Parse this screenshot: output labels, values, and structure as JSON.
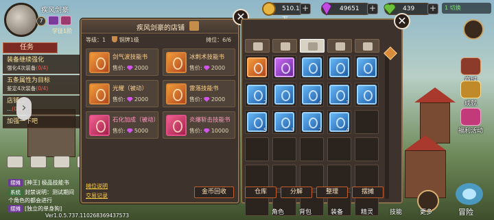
{
  "topbar": {
    "player_name": "疾风剑豪",
    "level": "7",
    "rank": "学徒1阶",
    "gold": "510.13万",
    "gems": "49651",
    "energy": "439",
    "status": "1 切换"
  },
  "tasks": {
    "tab_label": "任务",
    "items": [
      {
        "title": "装备继续强化",
        "desc": "强化4次装备",
        "progress": "(0/4)"
      },
      {
        "title": "五条属性为目标",
        "desc": "鉴定4次装备",
        "progress": "(0/4)"
      },
      {
        "title": "店铺...",
        "desc": "...",
        "progress": "(0/1)"
      },
      {
        "title": "加强一下吧",
        "desc": "",
        "progress": ""
      }
    ]
  },
  "chat": {
    "lines": [
      {
        "tag": "摆摊",
        "text": "[神王] 极品技能书"
      },
      {
        "tag": "系统",
        "text": "封禁说明：测试期间"
      },
      {
        "tag": "",
        "text": "个角色的都会进行"
      },
      {
        "tag": "摆摊",
        "text": "[独立的单身狗]"
      }
    ],
    "version": "Ver1.0.5.737.110268369437573"
  },
  "shop": {
    "title": "疾风剑豪的店铺",
    "level_label": "等级：",
    "level_value": "1",
    "rank": "铜牌1级",
    "stall_label": "摊位：",
    "stall_value": "6/6",
    "price_label": "售价:",
    "items": [
      {
        "name": "剑气波技能书",
        "price": "2000",
        "color": "orange"
      },
      {
        "name": "冰刺术技能书",
        "price": "2000",
        "color": "orange"
      },
      {
        "name": "光耀（被动）",
        "price": "2000",
        "color": "orange"
      },
      {
        "name": "雷落技能书",
        "price": "2000",
        "color": "orange"
      },
      {
        "name": "石化加成（被动）",
        "price": "5000",
        "color": "pink"
      },
      {
        "name": "炎爆斩击技能书",
        "price": "10000",
        "color": "pink"
      }
    ],
    "link_explain": "摊位说明",
    "link_records": "交易记录",
    "recycle_button": "金币回收"
  },
  "inventory": {
    "slots": [
      {
        "color": "orange",
        "count": ""
      },
      {
        "color": "purple",
        "count": ""
      },
      {
        "color": "blue",
        "count": ""
      },
      {
        "color": "blue",
        "count": ""
      },
      {
        "color": "blue",
        "count": ""
      },
      {
        "color": "blue",
        "count": "2"
      },
      {
        "color": "blue",
        "count": ""
      },
      {
        "color": "blue",
        "count": "4"
      },
      {
        "color": "blue",
        "count": "3"
      },
      {
        "color": "blue",
        "count": ""
      },
      {
        "color": "blue",
        "count": "5"
      },
      {
        "color": "blue",
        "count": "3"
      },
      {
        "color": "blue",
        "count": "2"
      },
      {
        "color": "blue",
        "count": "4"
      }
    ],
    "buttons": [
      "仓库",
      "分解",
      "整理",
      "摆摊"
    ]
  },
  "right_menu": [
    "商城",
    "成就",
    "福利活动"
  ],
  "bottom_nav": [
    "角色",
    "背包",
    "装备",
    "精灵",
    "技能",
    "更多",
    "冒险"
  ],
  "colors": {
    "panel": "#3d332c",
    "border": "#8a6d49",
    "accent": "#c25e2a",
    "gem": "#d055e8"
  }
}
